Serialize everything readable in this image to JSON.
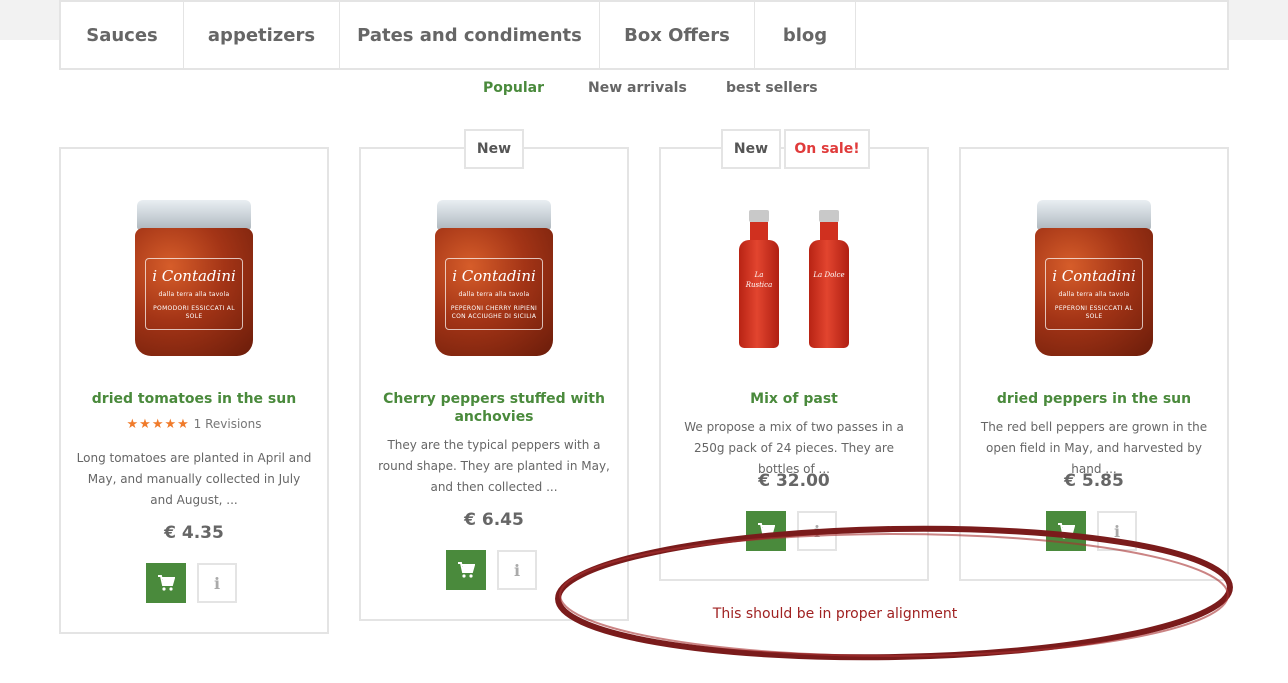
{
  "nav": {
    "categories": [
      "Sauces",
      "appetizers",
      "Pates and condiments",
      "Box Offers",
      "blog"
    ]
  },
  "tabs": [
    "Popular",
    "New arrivals",
    "best sellers"
  ],
  "products": [
    {
      "title": "dried tomatoes in the sun",
      "image_text": {
        "brand": "i Contadini",
        "sub": "dalla terra alla tavola",
        "label": "POMODORI ESSICCATI AL SOLE"
      },
      "rating_stars": 5,
      "reviews": "1 Revisions",
      "description": "Long tomatoes are planted in April and May, and manually collected in July and August, ...",
      "price": "€ 4.35"
    },
    {
      "badges": [
        "New"
      ],
      "title": "Cherry peppers stuffed with anchovies",
      "image_text": {
        "brand": "i Contadini",
        "sub": "dalla terra alla tavola",
        "label": "PEPERONI CHERRY RIPIENI CON ACCIUGHE DI SICILIA"
      },
      "description": "They are the typical peppers with a round shape. They are planted in May, and then collected ...",
      "price": "€ 6.45"
    },
    {
      "badges": [
        "New",
        "On sale!"
      ],
      "title": "Mix of past",
      "image_text": {
        "bottle1": "La Rustica",
        "bottle2": "La Dolce"
      },
      "description": "We propose a mix of two passes in a 250g pack of 24 pieces. They are bottles of ...",
      "price": "€ 32.00"
    },
    {
      "title": "dried peppers in the sun",
      "image_text": {
        "brand": "i Contadini",
        "sub": "dalla terra alla tavola",
        "label": "PEPERONI ESSICCATI AL SOLE"
      },
      "description": "The red bell peppers are grown in the open field in May, and harvested by hand ...",
      "price": "€ 5.85"
    }
  ],
  "annotation": {
    "text": "This should be in proper alignment",
    "color": "#a02222"
  },
  "colors": {
    "accent": "#4a8a3c",
    "sale": "#e03b3b",
    "star": "#f07b2b"
  },
  "icons": {
    "cart": "cart-icon",
    "info": "info-icon"
  }
}
